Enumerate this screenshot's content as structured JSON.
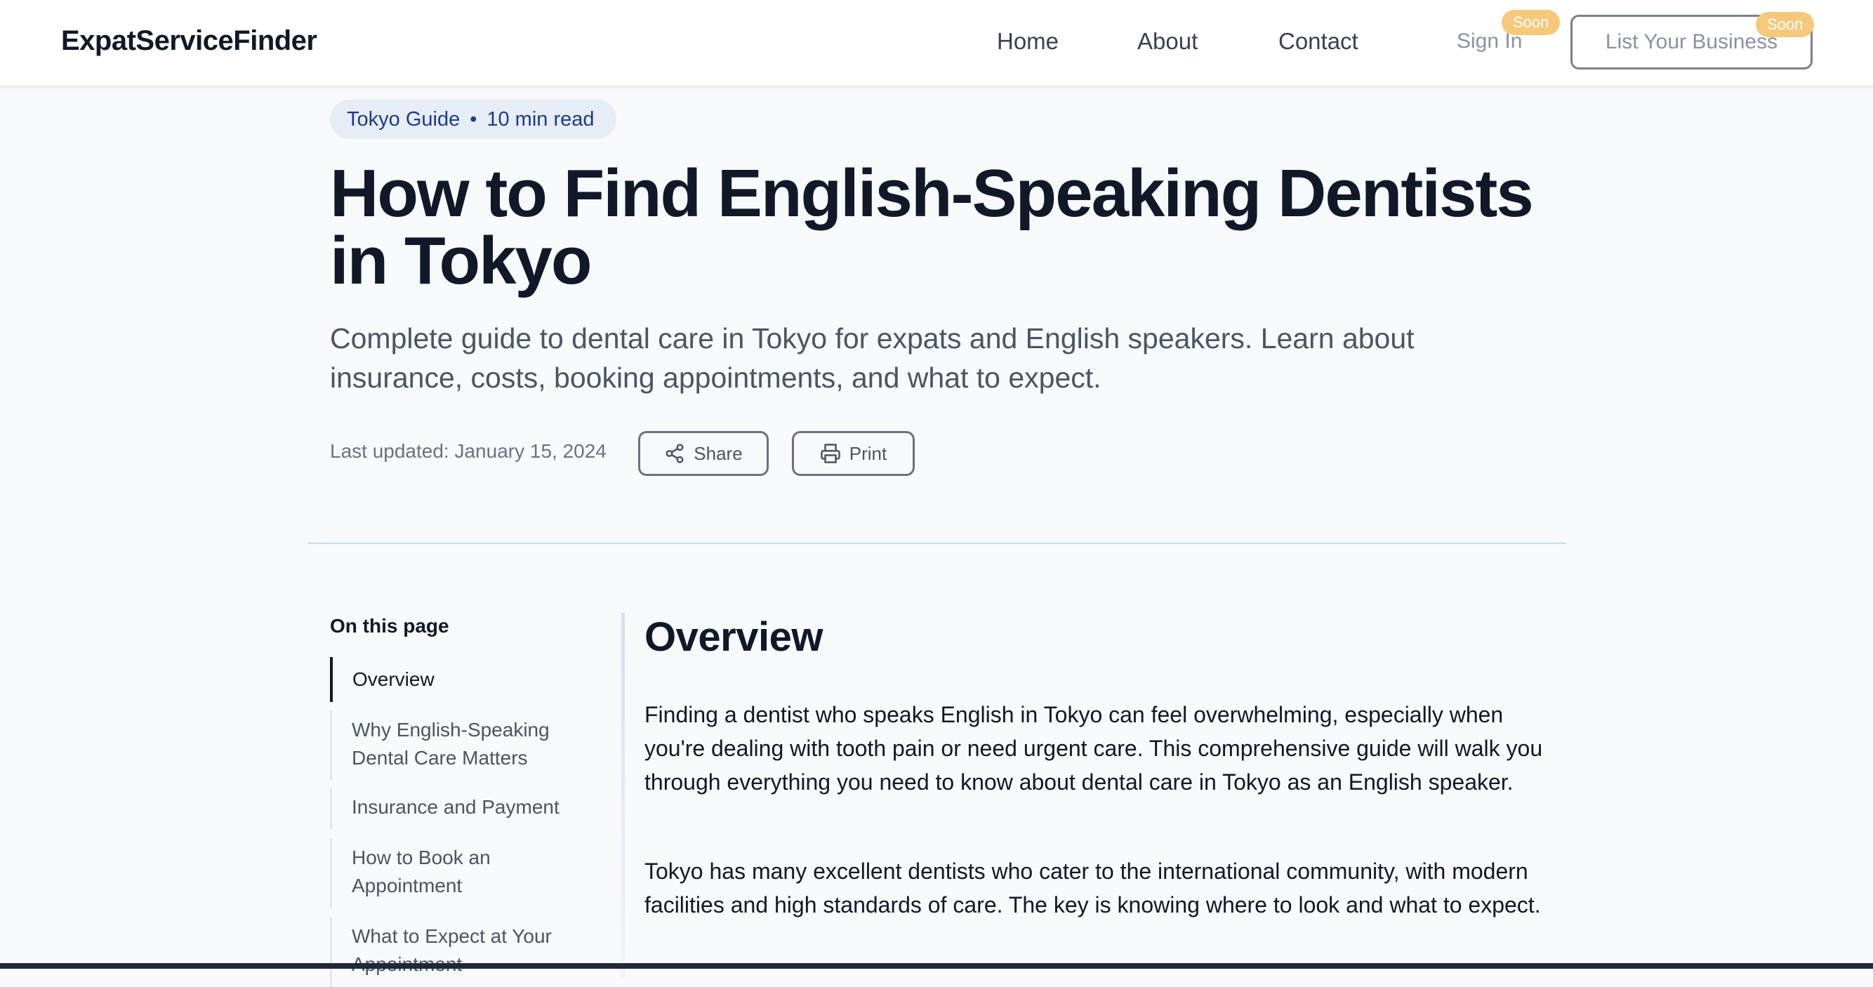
{
  "nav": {
    "brand": "ExpatServiceFinder",
    "links": [
      "Home",
      "About",
      "Contact"
    ],
    "sign_in": "Sign In",
    "soon_badge": "Soon",
    "list_business": "List Your Business"
  },
  "article": {
    "category": "Tokyo Guide",
    "separator": "•",
    "read_time": "10 min read",
    "title": "How to Find English-Speaking Dentists in Tokyo",
    "subtitle": "Complete guide to dental care in Tokyo for expats and English speakers. Learn about insurance, costs, booking appointments, and what to expect.",
    "last_updated": "Last updated: January 15, 2024",
    "share_label": "Share",
    "print_label": "Print"
  },
  "toc": {
    "heading": "On this page",
    "items": [
      "Overview",
      "Why English-Speaking Dental Care Matters",
      "Insurance and Payment",
      "How to Book an Appointment",
      "What to Expect at Your Appointment"
    ],
    "active_index": 0
  },
  "content": {
    "section_heading": "Overview",
    "paragraphs": [
      "Finding a dentist who speaks English in Tokyo can feel overwhelming, especially when you're dealing with tooth pain or need urgent care. This comprehensive guide will walk you through everything you need to know about dental care in Tokyo as an English speaker.",
      "Tokyo has many excellent dentists who cater to the international community, with modern facilities and high standards of care. The key is knowing where to look and what to expect."
    ]
  },
  "colors": {
    "soon_badge": "#f6c97a",
    "tag_pill_bg": "#e6edf6",
    "tag_pill_text": "#1e3a8a",
    "page_bg": "#f7f9fb"
  }
}
